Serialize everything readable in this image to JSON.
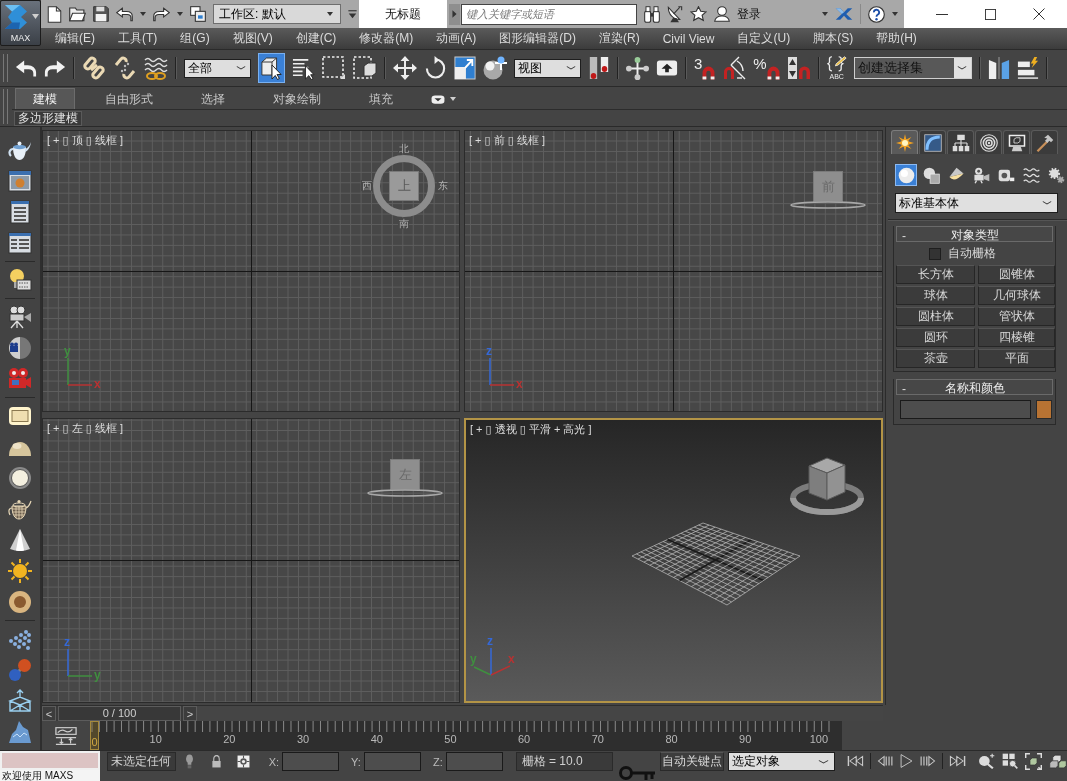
{
  "title_bar": {
    "app_button": "MAX",
    "workspace": "工作区: 默认",
    "title": "无标题",
    "search": {
      "placeholder": "键入关键字或短语"
    },
    "sign_in": "登录"
  },
  "menu_bar": [
    "编辑(E)",
    "工具(T)",
    "组(G)",
    "视图(V)",
    "创建(C)",
    "修改器(M)",
    "动画(A)",
    "图形编辑器(D)",
    "渲染(R)",
    "Civil View",
    "自定义(U)",
    "脚本(S)",
    "帮助(H)"
  ],
  "main_toolbar": {
    "selection_filter": "全部",
    "select_object_on": true,
    "coordinate_system": "视图",
    "snap_label": "3",
    "percent_label": "%",
    "named_sets_label": "ABC",
    "named_selection_set": "创建选择集"
  },
  "ribbon": {
    "tabs": [
      {
        "label": "建模",
        "selected": true
      },
      {
        "label": "自由形式",
        "selected": false
      },
      {
        "label": "选择",
        "selected": false
      },
      {
        "label": "对象绘制",
        "selected": false
      },
      {
        "label": "填充",
        "selected": false
      }
    ],
    "panel_tab": "多边形建模"
  },
  "viewports": [
    {
      "kind": "ortho",
      "label": "[ + ▯ 顶 ▯ 线框 ]",
      "active": false,
      "viewcube": {
        "kind": "compass",
        "face": "上",
        "compass": [
          {
            "label": "北",
            "kind": "north"
          },
          {
            "label": "西",
            "kind": "west"
          },
          {
            "label": "东",
            "kind": "east"
          },
          {
            "label": "南",
            "kind": "south"
          }
        ]
      },
      "axes": [
        {
          "label": "y",
          "kind": "up",
          "color": "#3f8f3f"
        },
        {
          "label": "x",
          "kind": "right",
          "color": "#b83232"
        }
      ]
    },
    {
      "kind": "ortho",
      "label": "[ + ▯ 前 ▯ 线框 ]",
      "active": false,
      "viewcube": {
        "kind": "flat",
        "face": "前"
      },
      "axes": [
        {
          "label": "z",
          "kind": "up",
          "color": "#3468d8"
        },
        {
          "label": "x",
          "kind": "right",
          "color": "#b83232"
        }
      ]
    },
    {
      "kind": "ortho",
      "label": "[ + ▯ 左 ▯ 线框 ]",
      "active": false,
      "viewcube": {
        "kind": "flat",
        "face": "左"
      },
      "axes": [
        {
          "label": "z",
          "kind": "up",
          "color": "#3468d8"
        },
        {
          "label": "y",
          "kind": "right",
          "color": "#3f8f3f"
        }
      ]
    },
    {
      "kind": "perspective",
      "label": "[ + ▯ 透视 ▯ 平滑 + 高光 ]",
      "active": true,
      "viewcube": {
        "kind": "cube"
      },
      "axes": [
        {
          "label": "y",
          "kind": "leftup",
          "color": "#3f8f3f"
        },
        {
          "label": "z",
          "kind": "up",
          "color": "#3468d8"
        },
        {
          "label": "x",
          "kind": "rightup",
          "color": "#b83232"
        }
      ]
    }
  ],
  "command_panel": {
    "tabs": [
      {
        "selected": true
      },
      {
        "selected": false
      },
      {
        "selected": false
      },
      {
        "selected": false
      },
      {
        "selected": false
      },
      {
        "selected": false
      }
    ],
    "categories": [
      {
        "selected": true
      },
      {
        "selected": false
      },
      {
        "selected": false
      },
      {
        "selected": false
      },
      {
        "selected": false
      },
      {
        "selected": false
      },
      {
        "selected": false
      }
    ],
    "object_category": "标准基本体",
    "rollouts": [
      {
        "kind": "object_type",
        "toggle": "-",
        "title": "对象类型",
        "expanded": true,
        "autogrid": {
          "label": "自动栅格",
          "checked": false
        },
        "buttons": [
          "长方体",
          "圆锥体",
          "球体",
          "几何球体",
          "圆柱体",
          "管状体",
          "圆环",
          "四棱锥",
          "茶壶",
          "平面"
        ]
      },
      {
        "kind": "name_color",
        "toggle": "-",
        "title": "名称和颜色",
        "expanded": true,
        "color": "#b87333"
      }
    ]
  },
  "time_slider": {
    "prev": "<",
    "position": "0 / 100",
    "next": ">",
    "level": 0
  },
  "track_bar": {
    "current_frame": "0",
    "labels": [
      "10",
      "20",
      "30",
      "40",
      "50",
      "60",
      "70",
      "80",
      "90",
      "100"
    ]
  },
  "status_bar": {
    "message": "欢迎使用 MAXS",
    "selection": "未选定任何",
    "coordinates": [
      {
        "label": "X:"
      },
      {
        "label": "Y:"
      },
      {
        "label": "Z:"
      }
    ],
    "grid": "栅格 = 10.0",
    "auto_key": {
      "label": "自动关键点",
      "on": false
    },
    "key_filter": "选定对象"
  }
}
